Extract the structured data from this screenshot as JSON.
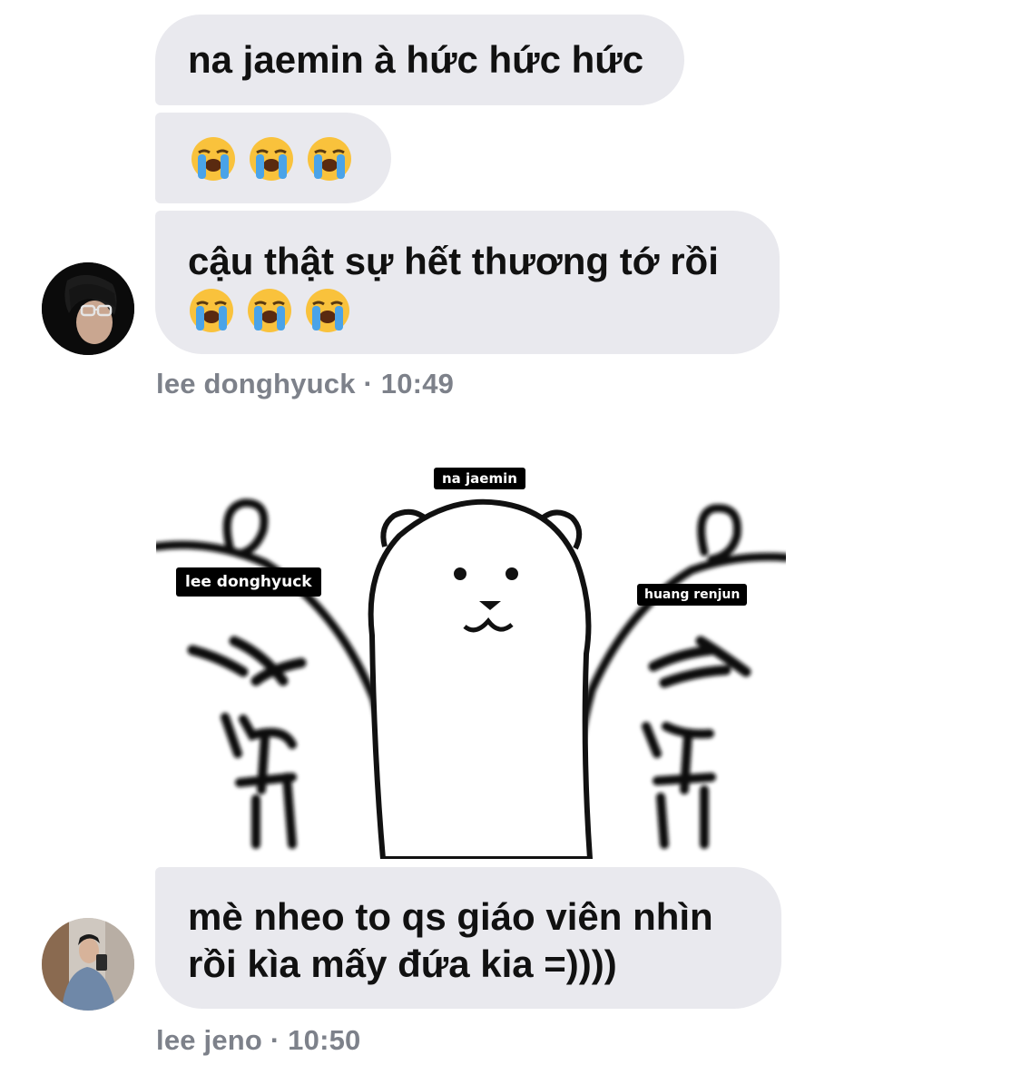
{
  "messages": {
    "m1": {
      "text": "na jaemin à hức hức hức"
    },
    "m2": {
      "emojis": [
        "loudly-crying-face",
        "loudly-crying-face",
        "loudly-crying-face"
      ]
    },
    "m3": {
      "text": "cậu thật sự hết thương tớ rồi",
      "emojis": [
        "loudly-crying-face",
        "loudly-crying-face",
        "loudly-crying-face"
      ]
    },
    "meta1": "lee donghyuck · 10:49",
    "m4": {
      "line1": "mè nheo to qs giáo viên nhìn",
      "line2": "rồi kìa mấy đứa kia =))))"
    },
    "meta2": "lee jeno · 10:50"
  },
  "meme": {
    "labels": {
      "center": "na jaemin",
      "left": "lee donghyuck",
      "right": "huang renjun"
    }
  },
  "colors": {
    "bubble_bg": "#e9e9ee",
    "meta_text": "#7d818a",
    "text": "#111111"
  }
}
